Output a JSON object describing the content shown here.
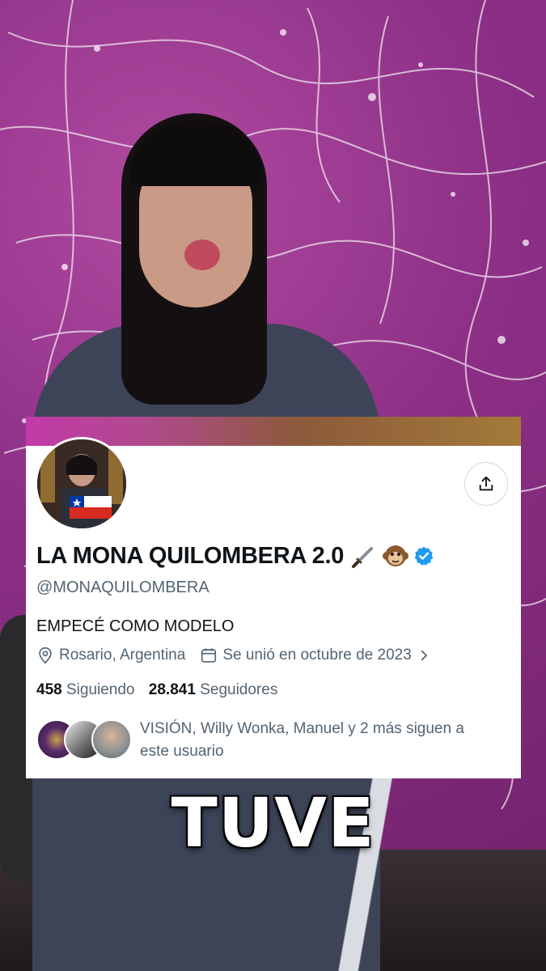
{
  "profile": {
    "display_name": "LA MONA QUILOMBERA 2.0",
    "name_emojis": "🗡️🐵",
    "handle": "@MONAQUILOMBERA",
    "bio": "EMPECÉ COMO MODELO",
    "location": "Rosario, Argentina",
    "joined": "Se unió en octubre de 2023",
    "following_count": "458",
    "following_label": "Siguiendo",
    "followers_count": "28.841",
    "followers_label": "Seguidores",
    "followed_by": "VISIÓN, Willy Wonka, Manuel y 2 más siguen a este usuario",
    "verified_color": "#1d9bf0"
  },
  "icons": {
    "share": "share-icon",
    "location": "location-pin-icon",
    "calendar": "calendar-icon",
    "chevron": "chevron-right-icon",
    "verified": "verified-badge-icon"
  },
  "caption": {
    "text": "TUVE"
  }
}
